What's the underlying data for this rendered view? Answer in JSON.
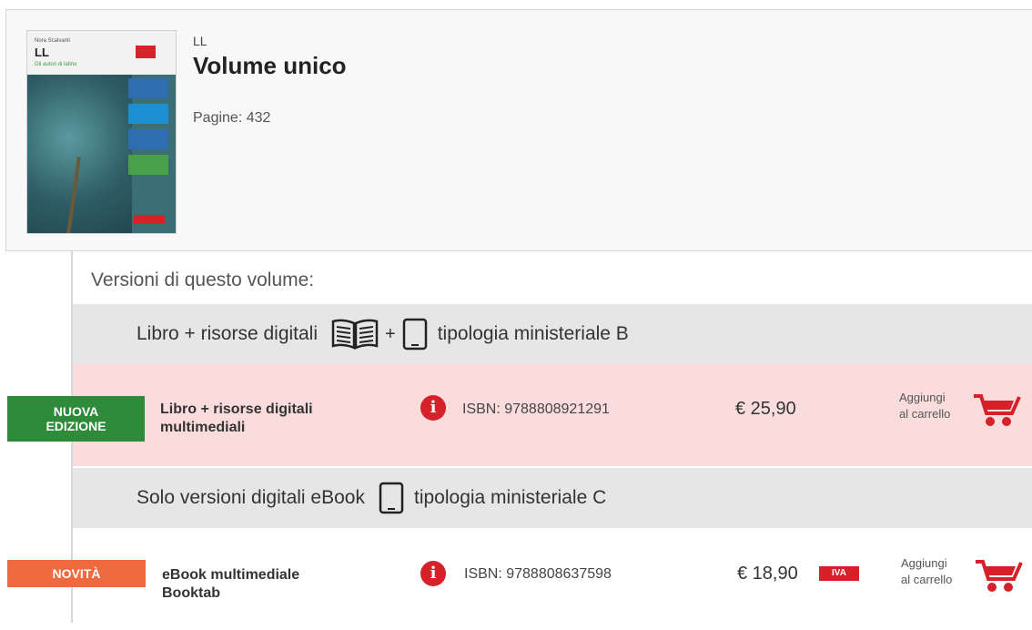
{
  "book": {
    "series": "LL",
    "title": "Volume unico",
    "pages": "Pagine: 432",
    "cover": {
      "title": "LL",
      "author_line": "Nora Scalvanti",
      "subtitle_line": "Gli autori di latino",
      "publisher": "ZANICHELLI"
    }
  },
  "versions_title": "Versioni di questo volume:",
  "groups": [
    {
      "label": "Libro + risorse digitali",
      "plus": "+",
      "tipologia": "tipologia ministeriale B",
      "icons": [
        "open-book-icon",
        "tablet-icon"
      ]
    },
    {
      "label": "Solo versioni digitali eBook",
      "tipologia": "tipologia ministeriale C",
      "icons": [
        "tablet-icon"
      ]
    }
  ],
  "products": [
    {
      "tag_line1": "NUOVA",
      "tag_line2": "EDIZIONE",
      "tag_color": "#2e8b3a",
      "name_line1": "Libro + risorse digitali",
      "name_line2": "multimediali",
      "info_icon": "info-icon",
      "isbn": "ISBN: 9788808921291",
      "price": "€ 25,90",
      "iva": "",
      "cart_line1": "Aggiungi",
      "cart_line2": "al carrello",
      "highlight": "#fbdcdc"
    },
    {
      "tag_line1": "NOVITÀ",
      "tag_color": "#ef6a3f",
      "name_line1": "eBook multimediale",
      "name_line2": "Booktab",
      "info_icon": "info-icon",
      "isbn": "ISBN: 9788808637598",
      "price": "€ 18,90",
      "iva": "IVA",
      "cart_line1": "Aggiungi",
      "cart_line2": "al carrello"
    }
  ],
  "colors": {
    "accent_red": "#d6202a",
    "group_bg": "#e6e6e6"
  }
}
